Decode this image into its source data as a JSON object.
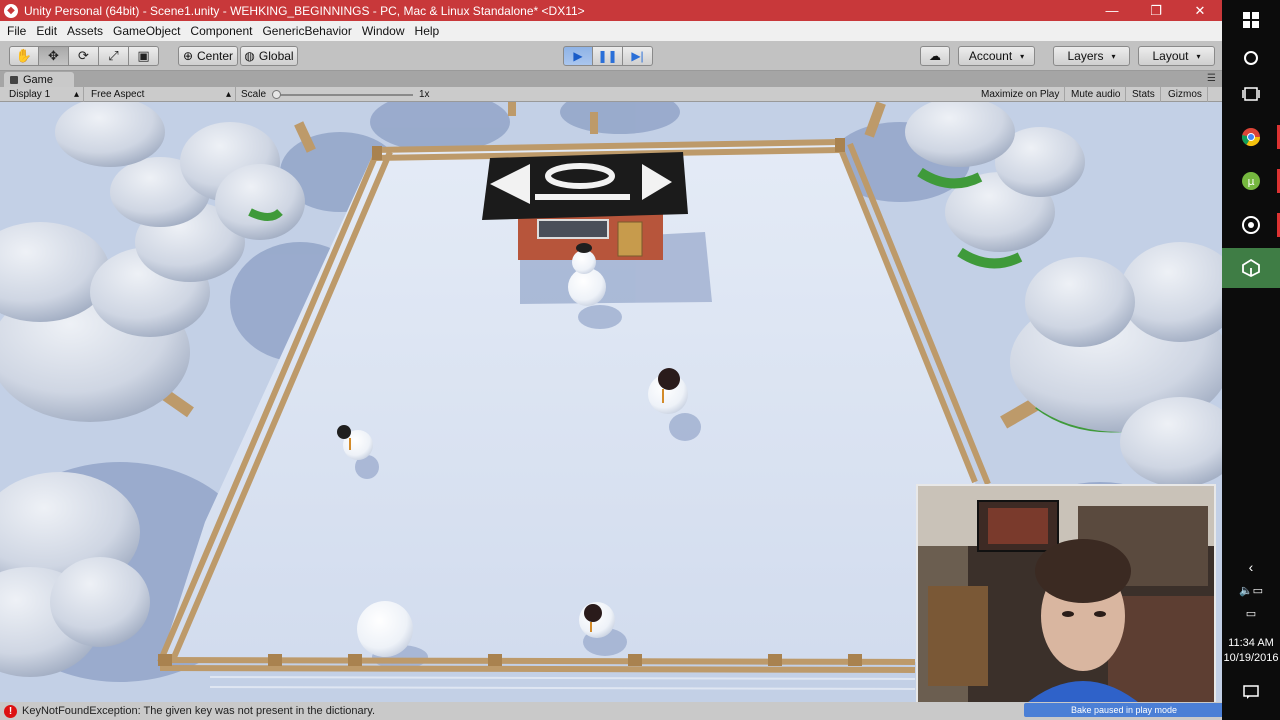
{
  "window": {
    "title": "Unity Personal (64bit) - Scene1.unity - WEHKING_BEGINNINGS - PC, Mac & Linux Standalone* <DX11>",
    "min_glyph": "—",
    "restore_glyph": "❐",
    "close_glyph": "✕"
  },
  "menu": [
    "File",
    "Edit",
    "Assets",
    "GameObject",
    "Component",
    "GenericBehavior",
    "Window",
    "Help"
  ],
  "toolbar": {
    "tool_icons": [
      "hand-icon",
      "move-icon",
      "rotate-icon",
      "scale-icon",
      "rect-icon"
    ],
    "tool_glyphs": [
      "✋",
      "✥",
      "⟳",
      "⤢",
      "▣"
    ],
    "pivot_label": "Center",
    "space_label": "Global",
    "play_glyph": "▶",
    "pause_glyph": "❚❚",
    "step_glyph": "▶|",
    "cloud_glyph": "☁",
    "account_label": "Account",
    "layers_label": "Layers",
    "layout_label": "Layout",
    "caret": "▾"
  },
  "game_tab": {
    "label": "Game",
    "display": "Display 1",
    "aspect": "Free Aspect",
    "scale_label": "Scale",
    "scale_value": "1x",
    "toggles": [
      "Maximize on Play",
      "Mute audio",
      "Stats",
      "Gizmos"
    ]
  },
  "status": {
    "error_text": "KeyNotFoundException: The given key was not present in the dictionary.",
    "bake_text": "Bake paused in play mode"
  },
  "taskbar": {
    "time": "11:34 AM",
    "date": "10/19/2016"
  },
  "colors": {
    "title_bar": "#c8383a",
    "snow_ground": "#dfe7f4",
    "fence": "#bf9d6e",
    "tree_foliage": "#d5dbe7",
    "tree_green": "#3f9a3a",
    "house_wall": "#b7553b",
    "taskbar": "#0c0c0c"
  }
}
